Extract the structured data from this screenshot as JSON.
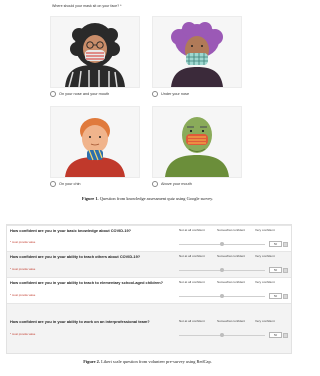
{
  "quiz": {
    "question": "Where should your mask sit on your face? *",
    "options": [
      {
        "label": "On your nose and your mouth",
        "avatar": "woman-glasses-striped-mask-avatar"
      },
      {
        "label": "Under your nose",
        "avatar": "purple-hair-checkered-mask-avatar"
      },
      {
        "label": "On your chin",
        "avatar": "redhead-chin-mask-avatar"
      },
      {
        "label": "Above your mouth",
        "avatar": "bald-man-mask-avatar"
      }
    ],
    "figure1": {
      "label": "Figure 1.",
      "text": " Question from knowledge assessment quiz using Google survey."
    }
  },
  "likert": {
    "columns": [
      "Not at all confident",
      "Somewhat confident",
      "Very confident"
    ],
    "required_note": "* must provide value",
    "rows": [
      {
        "question": "How confident are you in your basic knowledge about COVID-19?"
      },
      {
        "question": "How confident are you in your ability to teach others about COVID-19?"
      },
      {
        "question": "How confident are you in your ability to teach to elementary school-aged children?"
      },
      {
        "question": "How confident are you in your ability to work on an interprofessional team?"
      }
    ],
    "value_placeholder": "50",
    "figure2": {
      "label": "Figure 2.",
      "text": " Likert scale question from volunteer pre-survey using RedCap."
    }
  }
}
